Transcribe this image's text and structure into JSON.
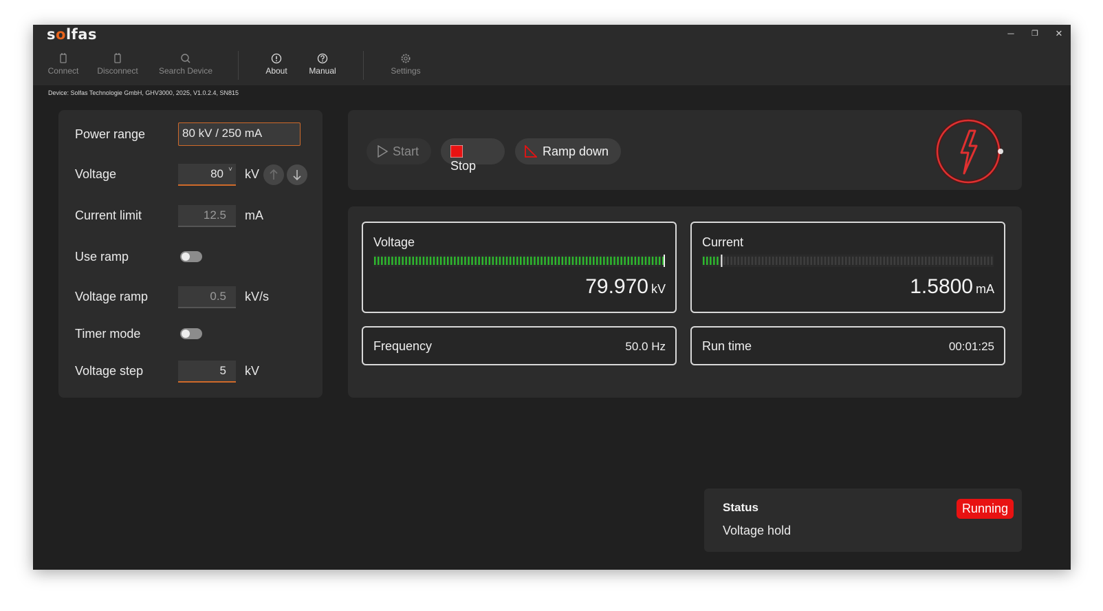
{
  "app": {
    "logo": "solfas"
  },
  "window_controls": {
    "minimize": "─",
    "restore": "❐",
    "close": "✕"
  },
  "toolbar": {
    "connect": "Connect",
    "disconnect": "Disconnect",
    "search": "Search Device",
    "about": "About",
    "manual": "Manual",
    "settings": "Settings"
  },
  "device_info": "Device: Solfas Technologie GmbH, GHV3000, 2025, V1.0.2.4, SN815",
  "settings": {
    "power_range": {
      "label": "Power range",
      "value": "80 kV / 250 mA"
    },
    "voltage": {
      "label": "Voltage",
      "value": "80",
      "unit": "kV"
    },
    "current_limit": {
      "label": "Current limit",
      "value": "12.5",
      "unit": "mA"
    },
    "use_ramp": {
      "label": "Use ramp",
      "on": false
    },
    "voltage_ramp": {
      "label": "Voltage ramp",
      "value": "0.5",
      "unit": "kV/s"
    },
    "timer_mode": {
      "label": "Timer mode",
      "on": false
    },
    "voltage_step": {
      "label": "Voltage step",
      "value": "5",
      "unit": "kV"
    }
  },
  "controls": {
    "start": "Start",
    "stop": "Stop",
    "ramp_down": "Ramp down"
  },
  "measurements": {
    "voltage": {
      "label": "Voltage",
      "value": "79.970",
      "unit": "kV",
      "fraction": 1.0
    },
    "current": {
      "label": "Current",
      "value": "1.5800",
      "unit": "mA",
      "fraction": 0.06
    },
    "frequency": {
      "label": "Frequency",
      "value": "50.0 Hz"
    },
    "run_time": {
      "label": "Run time",
      "value": "00:01:25"
    }
  },
  "status": {
    "heading": "Status",
    "badge": "Running",
    "text": "Voltage hold"
  },
  "colors": {
    "accent": "#d06a2a",
    "running": "#e81212",
    "bar_on": "#2eb82e",
    "bar_off": "#3e3e3e",
    "hv_indicator": "#e03030"
  }
}
